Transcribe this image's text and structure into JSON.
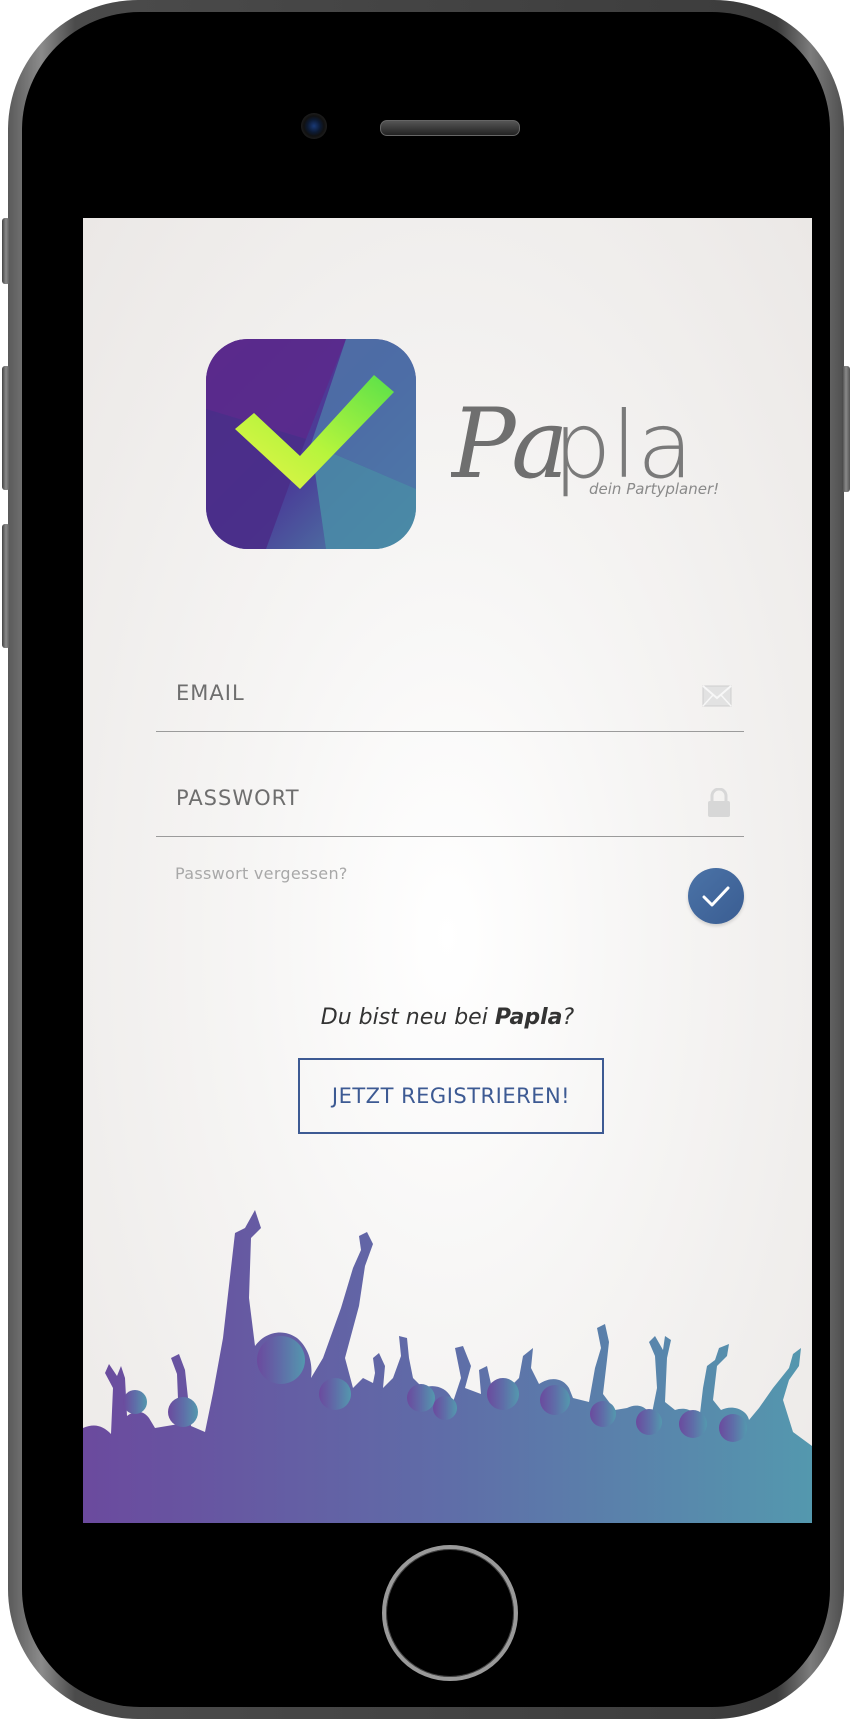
{
  "app": {
    "name_part1": "Pa",
    "name_part2": "pla",
    "tagline": "dein Partyplaner!"
  },
  "login": {
    "email_label": "EMAIL",
    "password_label": "PASSWORT",
    "forgot_label": "Passwort vergessen?"
  },
  "signup": {
    "prompt_prefix": "Du bist neu bei ",
    "prompt_brand": "Papla",
    "prompt_suffix": "?",
    "button_label": "JETZT REGISTRIEREN!"
  },
  "icons": {
    "app_logo": "checkmark-logo-icon",
    "email": "envelope-icon",
    "password": "lock-icon",
    "submit": "checkmark-icon"
  },
  "colors": {
    "accent": "#3d5a93",
    "submit_button": "#4168a0",
    "logo_purple": "#5b2b8c",
    "logo_teal": "#4a8fa7",
    "logo_check": "#a8f03a",
    "crowd_purple": "#6b4a9e",
    "crowd_teal": "#5498ae"
  }
}
